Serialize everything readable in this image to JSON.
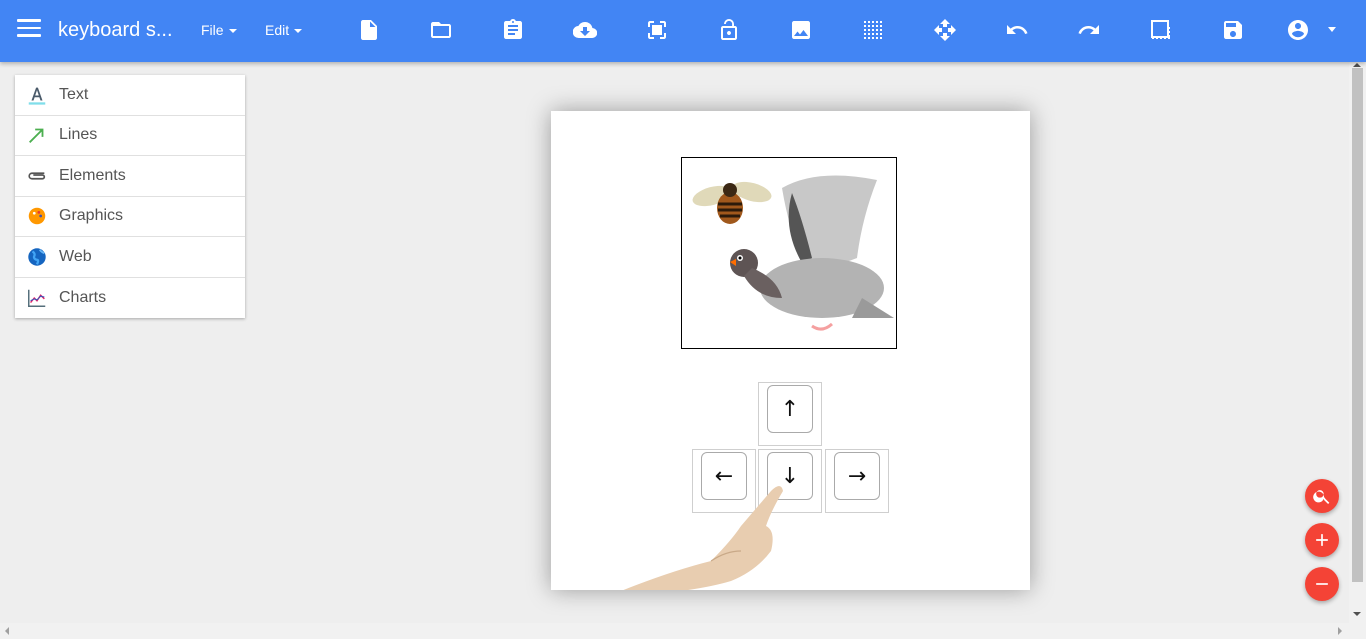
{
  "header": {
    "title": "keyboard s...",
    "menus": {
      "file": "File",
      "edit": "Edit"
    },
    "toolbar_icons": [
      "new-document-icon",
      "folder-open-icon",
      "clipboard-icon",
      "cloud-download-icon",
      "fullscreen-icon",
      "lock-open-icon",
      "image-icon",
      "grid-icon",
      "move-icon",
      "undo-icon",
      "redo-icon",
      "crop-icon",
      "save-icon",
      "account-icon"
    ],
    "accent_color": "#4285f4"
  },
  "sidebar": {
    "items": [
      {
        "label": "Text",
        "icon": "text-icon"
      },
      {
        "label": "Lines",
        "icon": "arrow-line-icon"
      },
      {
        "label": "Elements",
        "icon": "paperclip-icon"
      },
      {
        "label": "Graphics",
        "icon": "palette-icon"
      },
      {
        "label": "Web",
        "icon": "globe-icon"
      },
      {
        "label": "Charts",
        "icon": "line-chart-icon"
      }
    ]
  },
  "canvas": {
    "keys": {
      "up": "↑",
      "left": "←",
      "down": "↓",
      "right": "→"
    },
    "image_content": [
      "bee",
      "pigeon"
    ]
  },
  "fabs": [
    "zoom-search-icon",
    "zoom-in-icon",
    "zoom-out-icon"
  ],
  "fab_color": "#f44336"
}
